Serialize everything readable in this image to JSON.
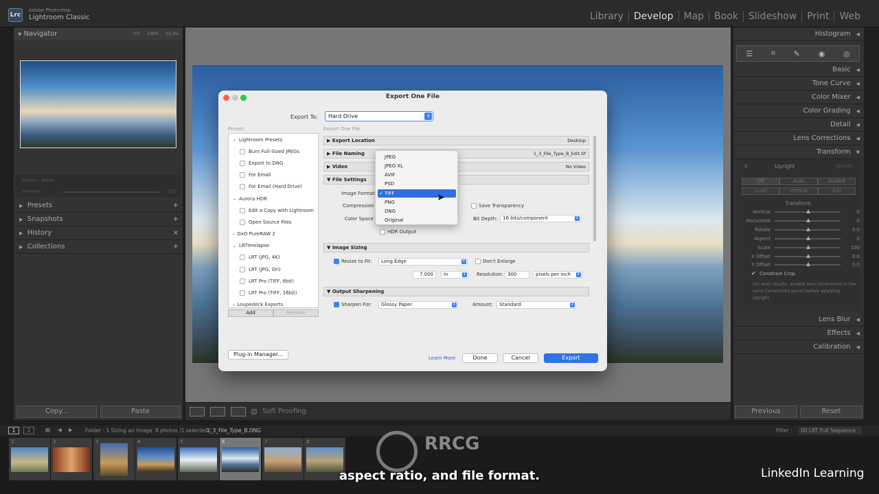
{
  "app": {
    "line1": "Adobe Photoshop",
    "line2": "Lightroom Classic",
    "logo": "Lrc"
  },
  "modules": [
    "Library",
    "Develop",
    "Map",
    "Book",
    "Slideshow",
    "Print",
    "Web"
  ],
  "active_module": "Develop",
  "left_panel": {
    "navigator": "Navigator",
    "zoom": [
      "FIT",
      "100%",
      "33.3%"
    ],
    "preset_label": "Preset : None",
    "amount_label": "Amount",
    "amount_value": "100",
    "sections": [
      "Presets",
      "Snapshots",
      "History",
      "Collections"
    ],
    "copy": "Copy...",
    "paste": "Paste"
  },
  "toolbar": {
    "soft_proofing": "Soft Proofing"
  },
  "dialog": {
    "title": "Export One File",
    "export_to_label": "Export To:",
    "export_to_value": "Hard Drive",
    "preset_label": "Preset:",
    "export_one_label": "Export One File",
    "presets": [
      {
        "label": "Lightroom Presets",
        "level": 0
      },
      {
        "label": "Burn Full-Sized JPEGs",
        "level": 1
      },
      {
        "label": "Export to DNG",
        "level": 1
      },
      {
        "label": "For Email",
        "level": 1
      },
      {
        "label": "For Email (Hard Drive)",
        "level": 1
      },
      {
        "label": "Aurora HDR",
        "level": 0
      },
      {
        "label": "Edit a Copy with Lightroom",
        "level": 1
      },
      {
        "label": "Open Source Files",
        "level": 1
      },
      {
        "label": "DxO PureRAW 2",
        "level": 0
      },
      {
        "label": "LRTimelapse",
        "level": 0
      },
      {
        "label": "LRT (JPG, 4K)",
        "level": 1
      },
      {
        "label": "LRT (JPG, Ori)",
        "level": 1
      },
      {
        "label": "LRT Pro (TIFF, 8bit)",
        "level": 1
      },
      {
        "label": "LRT Pro (TIFF, 16bit)",
        "level": 1
      },
      {
        "label": "Loupedeck Exports",
        "level": 0
      }
    ],
    "add": "Add",
    "remove": "Remove",
    "sections": {
      "export_location": {
        "title": "Export Location",
        "value": "Desktop"
      },
      "file_naming": {
        "title": "File Naming",
        "value": "1_3_File_Type_B_Edit.tif"
      },
      "video": {
        "title": "Video",
        "value": "No Video"
      },
      "file_settings": {
        "title": "File Settings"
      },
      "image_sizing": {
        "title": "Image Sizing"
      },
      "output_sharpening": {
        "title": "Output Sharpening"
      }
    },
    "file_settings": {
      "image_format_label": "Image Format",
      "compression_label": "Compression",
      "color_space_label": "Color Space",
      "save_transparency": "Save Transparency",
      "bit_depth_label": "Bit Depth:",
      "bit_depth_value": "16 bits/component",
      "hdr_output": "HDR Output"
    },
    "image_sizing": {
      "resize_label": "Resize to Fit:",
      "resize_value": "Long Edge",
      "dont_enlarge": "Don't Enlarge",
      "size_value": "7.000",
      "size_unit": "in",
      "resolution_label": "Resolution:",
      "resolution_value": "300",
      "resolution_unit": "pixels per inch"
    },
    "sharpening": {
      "sharpen_label": "Sharpen For:",
      "sharpen_value": "Glossy Paper",
      "amount_label": "Amount:",
      "amount_value": "Standard"
    },
    "format_options": [
      "JPEG",
      "JPEG XL",
      "AVIF",
      "PSD",
      "TIFF",
      "PNG",
      "DNG",
      "Original"
    ],
    "selected_format": "TIFF",
    "plugin_manager": "Plug-in Manager...",
    "learn_more": "Learn More",
    "done": "Done",
    "cancel": "Cancel",
    "export": "Export"
  },
  "right_panel": {
    "histogram": "Histogram",
    "sections": [
      "Basic",
      "Tone Curve",
      "Color Mixer",
      "Color Grading",
      "Detail",
      "Lens Corrections",
      "Transform"
    ],
    "upright": "Upright",
    "update": "Update",
    "upright_buttons_row1": [
      "Off",
      "Auto",
      "Guided"
    ],
    "upright_buttons_row2": [
      "Level",
      "Vertical",
      "Full"
    ],
    "transform_label": "Transform",
    "sliders": [
      {
        "name": "Vertical",
        "value": "0"
      },
      {
        "name": "Horizontal",
        "value": "0"
      },
      {
        "name": "Rotate",
        "value": "0.0"
      },
      {
        "name": "Aspect",
        "value": "0"
      },
      {
        "name": "Scale",
        "value": "100"
      },
      {
        "name": "X Offset",
        "value": "0.0"
      },
      {
        "name": "Y Offset",
        "value": "0.0"
      }
    ],
    "constrain_crop": "Constrain Crop",
    "note": "For best results, enable lens corrections in the Lens Corrections panel before applying Upright.",
    "bottom_sections": [
      "Lens Blur",
      "Effects",
      "Calibration"
    ],
    "previous": "Previous",
    "reset": "Reset"
  },
  "filmstrip": {
    "pages": [
      "1",
      "2"
    ],
    "folder": "Folder : 1 Sizing an Image",
    "count": "8 photos /1 selected /",
    "filename": "1_3_File_Type_B.DNG",
    "filter_label": "Filter :",
    "filter_value": "00 LRT Full Sequence",
    "thumbs": [
      "1",
      "2",
      "3",
      "4",
      "5",
      "6",
      "7",
      "8"
    ]
  },
  "caption": "aspect ratio, and file format.",
  "brand": "LinkedIn Learning"
}
